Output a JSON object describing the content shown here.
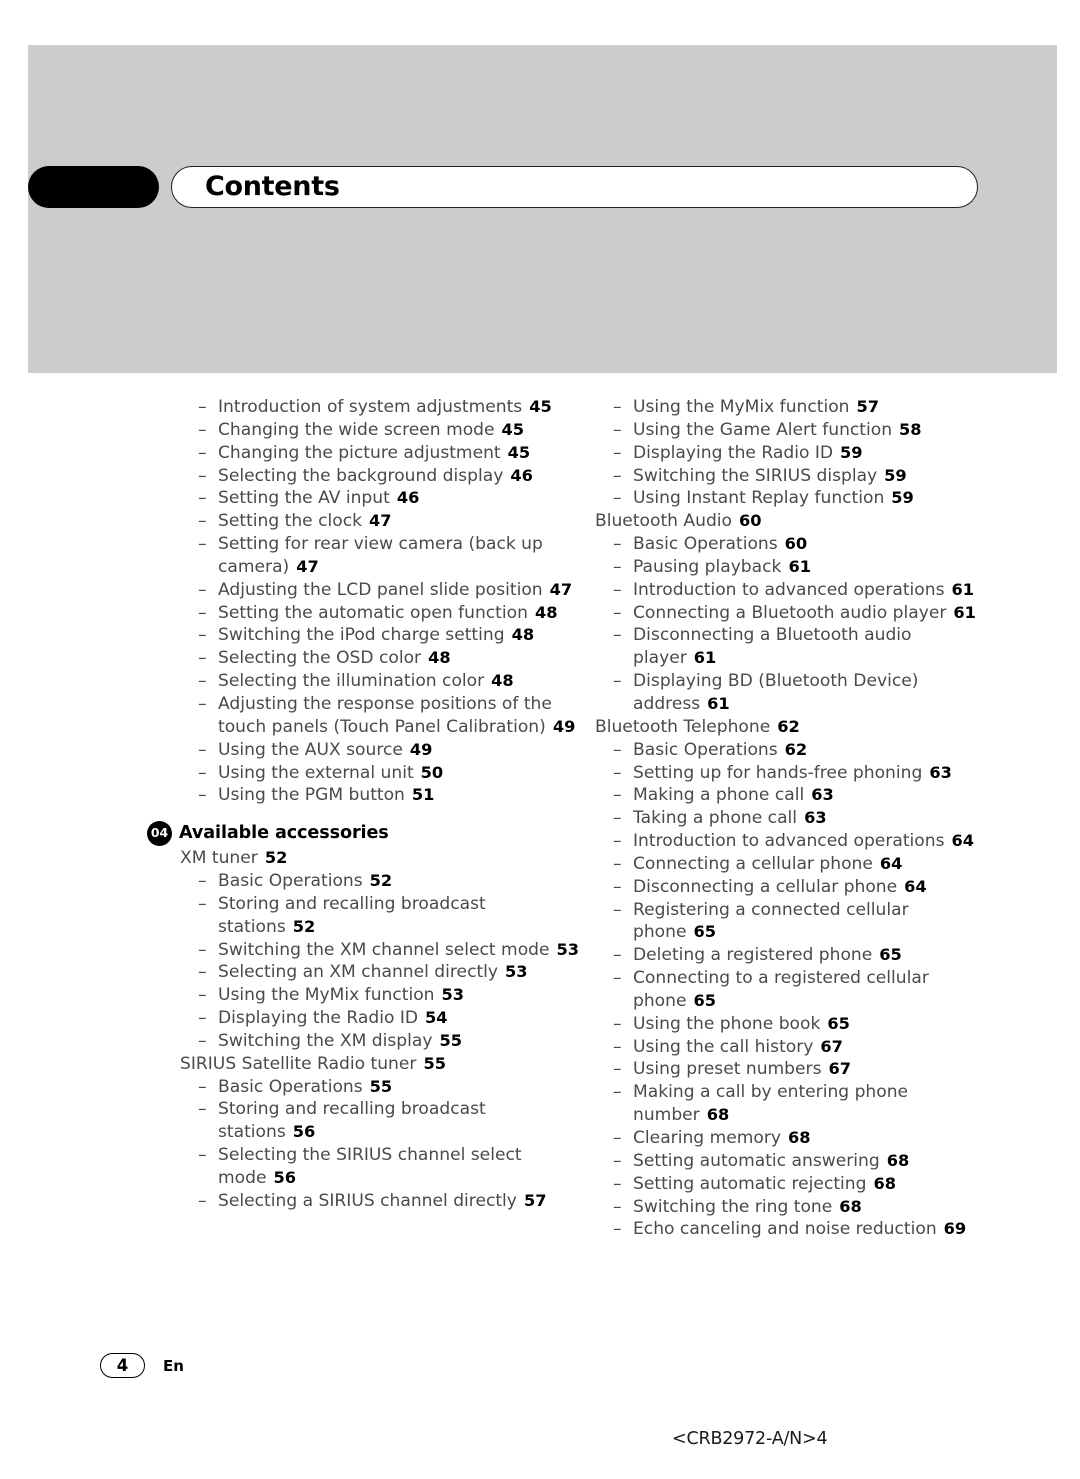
{
  "header": {
    "title": "Contents",
    "tab_icon": "black-tab-marker"
  },
  "footer": {
    "page_number": "4",
    "language": "En",
    "document_code": "<CRB2972-A/N>4"
  },
  "toc": {
    "left_column": [
      {
        "kind": "sub",
        "text": "Introduction of system adjustments",
        "page": "45"
      },
      {
        "kind": "sub",
        "text": "Changing the wide screen mode",
        "page": "45"
      },
      {
        "kind": "sub",
        "text": "Changing the picture adjustment",
        "page": "45"
      },
      {
        "kind": "sub",
        "text": "Selecting the background display",
        "page": "46"
      },
      {
        "kind": "sub",
        "text": "Setting the AV input",
        "page": "46"
      },
      {
        "kind": "sub",
        "text": "Setting the clock",
        "page": "47"
      },
      {
        "kind": "sub",
        "text": "Setting for rear view camera (back up camera)",
        "page": "47"
      },
      {
        "kind": "sub",
        "text": "Adjusting the LCD panel slide position",
        "page": "47"
      },
      {
        "kind": "sub",
        "text": "Setting the automatic open function",
        "page": "48"
      },
      {
        "kind": "sub",
        "text": "Switching the iPod charge setting",
        "page": "48"
      },
      {
        "kind": "sub",
        "text": "Selecting the OSD color",
        "page": "48"
      },
      {
        "kind": "sub",
        "text": "Selecting the illumination color",
        "page": "48"
      },
      {
        "kind": "sub",
        "text": "Adjusting the response positions of the touch panels (Touch Panel Calibration)",
        "page": "49"
      },
      {
        "kind": "sub",
        "text": "Using the AUX source",
        "page": "49"
      },
      {
        "kind": "sub",
        "text": "Using the external unit",
        "page": "50"
      },
      {
        "kind": "sub",
        "text": "Using the PGM button",
        "page": "51"
      },
      {
        "kind": "section",
        "number": "04",
        "text": "Available accessories"
      },
      {
        "kind": "top",
        "text": "XM tuner",
        "page": "52"
      },
      {
        "kind": "sub",
        "text": "Basic Operations",
        "page": "52"
      },
      {
        "kind": "sub",
        "text": "Storing and recalling broadcast stations",
        "page": "52"
      },
      {
        "kind": "sub",
        "text": "Switching the XM channel select mode",
        "page": "53"
      },
      {
        "kind": "sub",
        "text": "Selecting an XM channel directly",
        "page": "53"
      },
      {
        "kind": "sub",
        "text": "Using the MyMix function",
        "page": "53"
      },
      {
        "kind": "sub",
        "text": "Displaying the Radio ID",
        "page": "54"
      },
      {
        "kind": "sub",
        "text": "Switching the XM display",
        "page": "55"
      },
      {
        "kind": "top",
        "text": "SIRIUS Satellite Radio tuner",
        "page": "55"
      },
      {
        "kind": "sub",
        "text": "Basic Operations",
        "page": "55"
      },
      {
        "kind": "sub",
        "text": "Storing and recalling broadcast stations",
        "page": "56"
      },
      {
        "kind": "sub",
        "text": "Selecting the SIRIUS channel select mode",
        "page": "56"
      },
      {
        "kind": "sub",
        "text": "Selecting a SIRIUS channel directly",
        "page": "57"
      }
    ],
    "right_column": [
      {
        "kind": "sub",
        "text": "Using the MyMix function",
        "page": "57"
      },
      {
        "kind": "sub",
        "text": "Using the Game Alert function",
        "page": "58"
      },
      {
        "kind": "sub",
        "text": "Displaying the Radio ID",
        "page": "59"
      },
      {
        "kind": "sub",
        "text": "Switching the SIRIUS display",
        "page": "59"
      },
      {
        "kind": "sub",
        "text": "Using Instant Replay function",
        "page": "59"
      },
      {
        "kind": "top",
        "text": "Bluetooth Audio",
        "page": "60"
      },
      {
        "kind": "sub",
        "text": "Basic Operations",
        "page": "60"
      },
      {
        "kind": "sub",
        "text": "Pausing playback",
        "page": "61"
      },
      {
        "kind": "sub",
        "text": "Introduction to advanced operations",
        "page": "61"
      },
      {
        "kind": "sub",
        "text": "Connecting a Bluetooth audio player",
        "page": "61"
      },
      {
        "kind": "sub",
        "text": "Disconnecting a Bluetooth audio player",
        "page": "61"
      },
      {
        "kind": "sub",
        "text": "Displaying BD (Bluetooth Device) address",
        "page": "61"
      },
      {
        "kind": "top",
        "text": "Bluetooth Telephone",
        "page": "62"
      },
      {
        "kind": "sub",
        "text": "Basic Operations",
        "page": "62"
      },
      {
        "kind": "sub",
        "text": "Setting up for hands-free phoning",
        "page": "63"
      },
      {
        "kind": "sub",
        "text": "Making a phone call",
        "page": "63"
      },
      {
        "kind": "sub",
        "text": "Taking a phone call",
        "page": "63"
      },
      {
        "kind": "sub",
        "text": "Introduction to advanced operations",
        "page": "64"
      },
      {
        "kind": "sub",
        "text": "Connecting a cellular phone",
        "page": "64"
      },
      {
        "kind": "sub",
        "text": "Disconnecting a cellular phone",
        "page": "64"
      },
      {
        "kind": "sub",
        "text": "Registering a connected cellular phone",
        "page": "65"
      },
      {
        "kind": "sub",
        "text": "Deleting a registered phone",
        "page": "65"
      },
      {
        "kind": "sub",
        "text": "Connecting to a registered cellular phone",
        "page": "65"
      },
      {
        "kind": "sub",
        "text": "Using the phone book",
        "page": "65"
      },
      {
        "kind": "sub",
        "text": "Using the call history",
        "page": "67"
      },
      {
        "kind": "sub",
        "text": "Using preset numbers",
        "page": "67"
      },
      {
        "kind": "sub",
        "text": "Making a call by entering phone number",
        "page": "68"
      },
      {
        "kind": "sub",
        "text": "Clearing memory",
        "page": "68"
      },
      {
        "kind": "sub",
        "text": "Setting automatic answering",
        "page": "68"
      },
      {
        "kind": "sub",
        "text": "Setting automatic rejecting",
        "page": "68"
      },
      {
        "kind": "sub",
        "text": "Switching the ring tone",
        "page": "68"
      },
      {
        "kind": "sub",
        "text": "Echo canceling and noise reduction",
        "page": "69"
      }
    ]
  },
  "symbols": {
    "dash": "–"
  }
}
